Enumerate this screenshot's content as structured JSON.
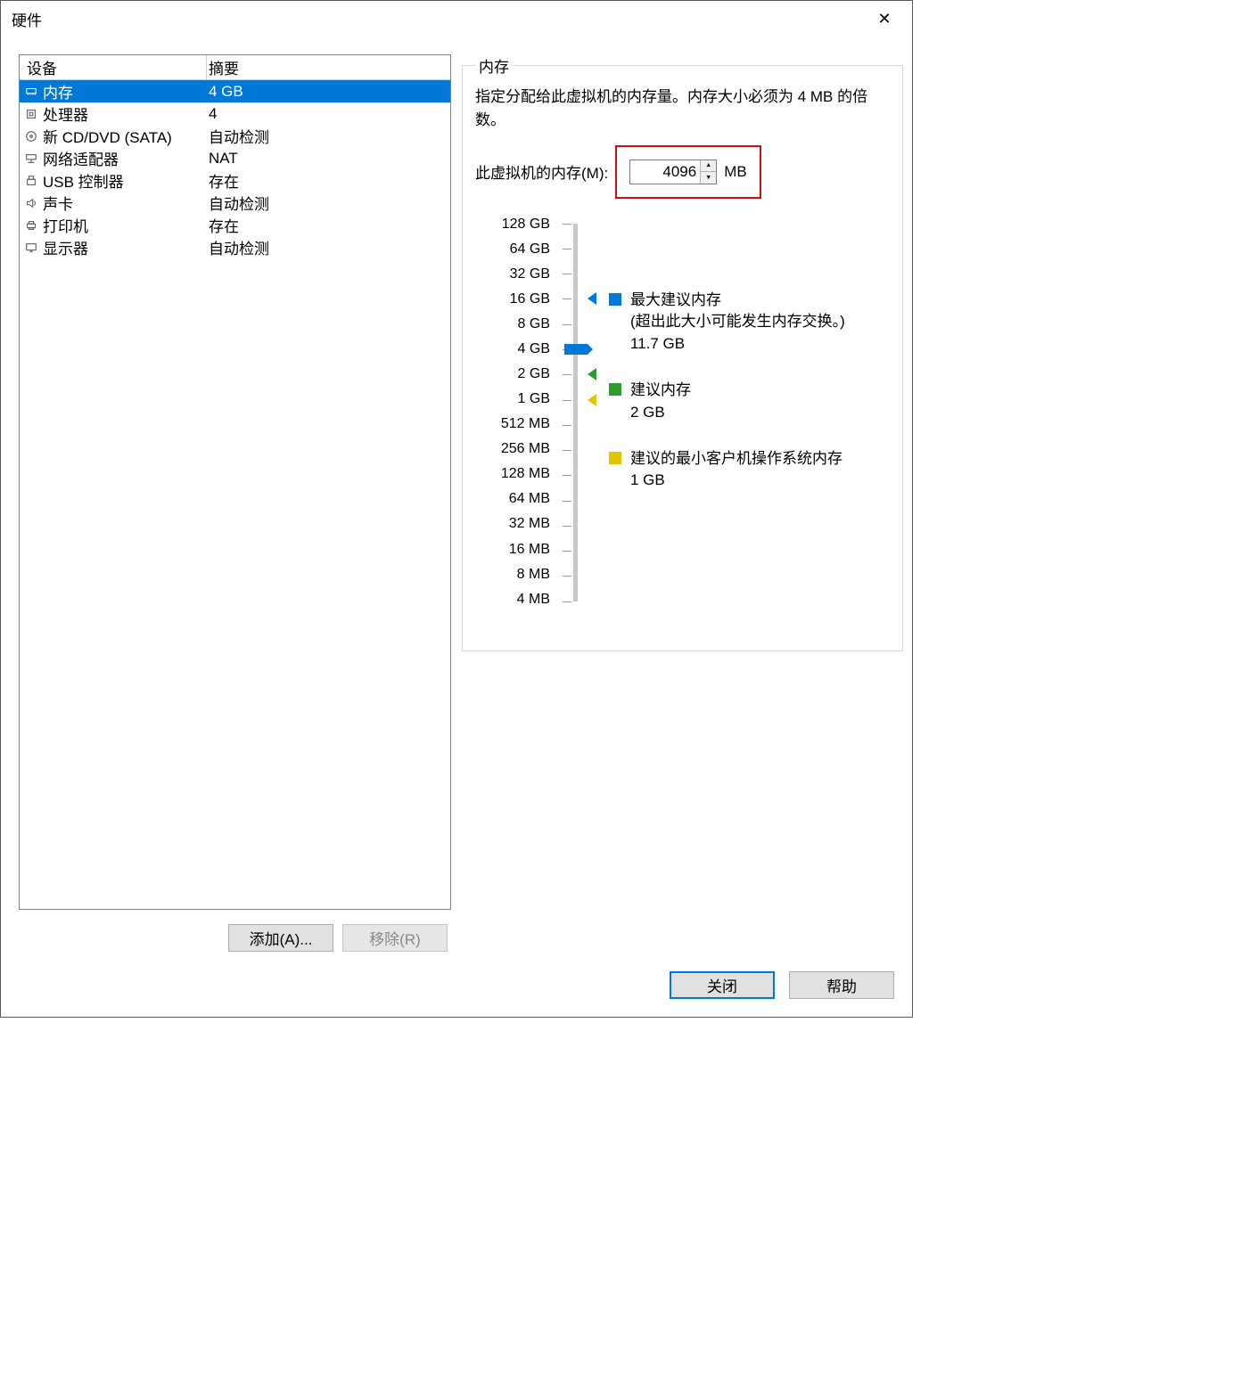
{
  "window": {
    "title": "硬件"
  },
  "deviceTable": {
    "headers": {
      "device": "设备",
      "summary": "摘要"
    },
    "rows": [
      {
        "icon": "memory-icon",
        "name": "内存",
        "summary": "4 GB",
        "selected": true
      },
      {
        "icon": "cpu-icon",
        "name": "处理器",
        "summary": "4",
        "selected": false
      },
      {
        "icon": "disc-icon",
        "name": "新 CD/DVD (SATA)",
        "summary": "自动检测",
        "selected": false
      },
      {
        "icon": "network-icon",
        "name": "网络适配器",
        "summary": "NAT",
        "selected": false
      },
      {
        "icon": "usb-icon",
        "name": "USB 控制器",
        "summary": "存在",
        "selected": false
      },
      {
        "icon": "sound-icon",
        "name": "声卡",
        "summary": "自动检测",
        "selected": false
      },
      {
        "icon": "printer-icon",
        "name": "打印机",
        "summary": "存在",
        "selected": false
      },
      {
        "icon": "display-icon",
        "name": "显示器",
        "summary": "自动检测",
        "selected": false
      }
    ]
  },
  "leftButtons": {
    "add": "添加(A)...",
    "remove": "移除(R)"
  },
  "memoryPane": {
    "legendTitle": "内存",
    "description": "指定分配给此虚拟机的内存量。内存大小必须为 4 MB 的倍数。",
    "inputLabel": "此虚拟机的内存(M):",
    "inputValue": "4096",
    "inputUnit": "MB",
    "scale": [
      "128 GB",
      "64 GB",
      "32 GB",
      "16 GB",
      "8 GB",
      "4 GB",
      "2 GB",
      "1 GB",
      "512 MB",
      "256 MB",
      "128 MB",
      "64 MB",
      "32 MB",
      "16 MB",
      "8 MB",
      "4 MB"
    ],
    "currentIndex": 5,
    "markers": {
      "maxRecommended": {
        "index": 3,
        "color": "blue"
      },
      "recommended": {
        "index": 6,
        "color": "green"
      },
      "minimum": {
        "index": 7,
        "color": "yellow"
      }
    },
    "legendItems": {
      "max": {
        "title": "最大建议内存",
        "note": "(超出此大小可能发生内存交换。)",
        "value": "11.7 GB"
      },
      "rec": {
        "title": "建议内存",
        "value": "2 GB"
      },
      "min": {
        "title": "建议的最小客户机操作系统内存",
        "value": "1 GB"
      }
    }
  },
  "footer": {
    "close": "关闭",
    "help": "帮助"
  }
}
